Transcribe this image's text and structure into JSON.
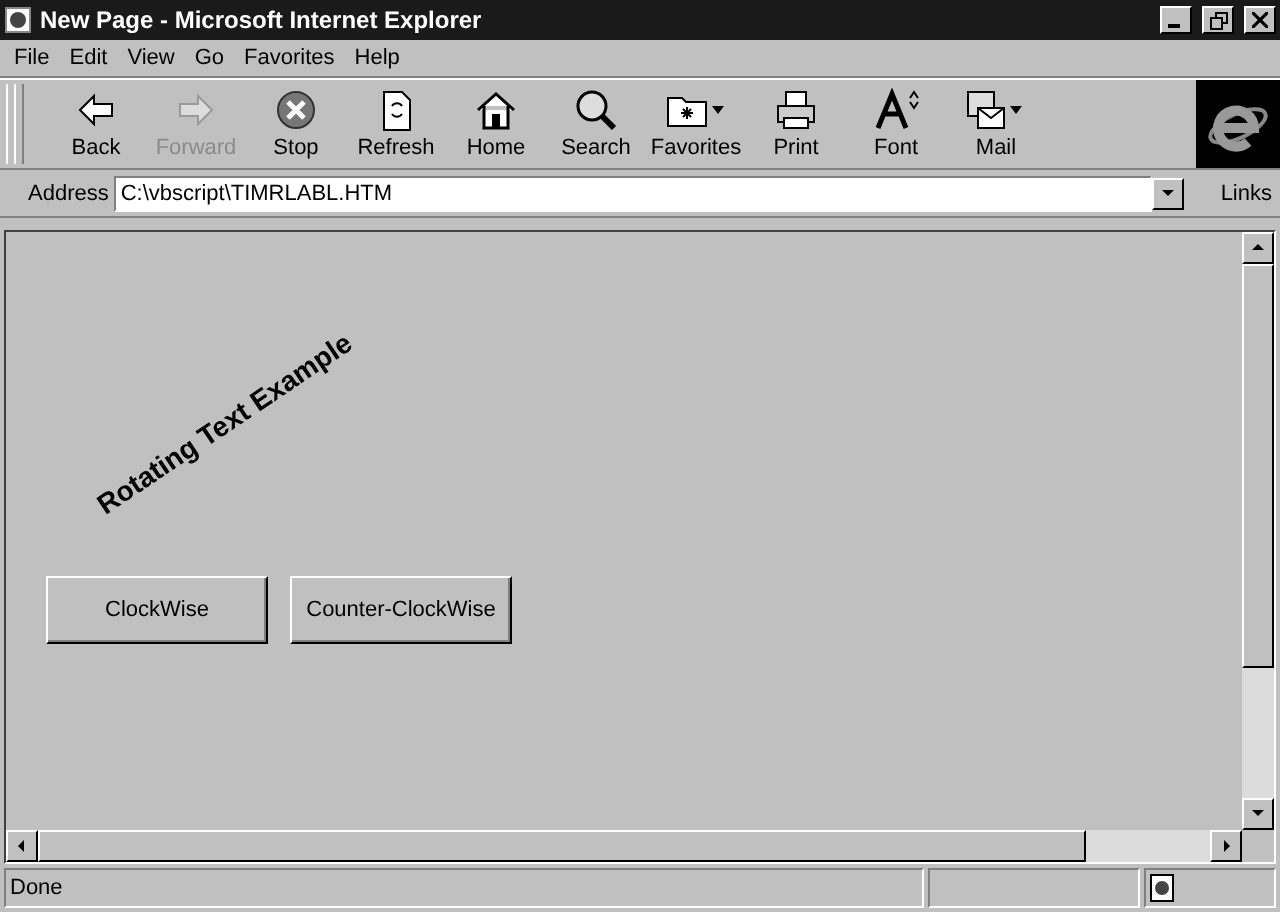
{
  "window": {
    "title": "New Page - Microsoft Internet Explorer"
  },
  "menu": [
    {
      "label": "File"
    },
    {
      "label": "Edit"
    },
    {
      "label": "View"
    },
    {
      "label": "Go"
    },
    {
      "label": "Favorites"
    },
    {
      "label": "Help"
    }
  ],
  "toolbar": [
    {
      "label": "Back",
      "kind": "back",
      "disabled": false
    },
    {
      "label": "Forward",
      "kind": "forward",
      "disabled": true
    },
    {
      "label": "Stop",
      "kind": "stop",
      "disabled": false
    },
    {
      "label": "Refresh",
      "kind": "refresh",
      "disabled": false
    },
    {
      "label": "Home",
      "kind": "home",
      "disabled": false
    },
    {
      "label": "Search",
      "kind": "search",
      "disabled": false
    },
    {
      "label": "Favorites",
      "kind": "favorites",
      "disabled": false
    },
    {
      "label": "Print",
      "kind": "print",
      "disabled": false
    },
    {
      "label": "Font",
      "kind": "font",
      "disabled": false
    },
    {
      "label": "Mail",
      "kind": "mail",
      "disabled": false
    }
  ],
  "address": {
    "label": "Address",
    "value": "C:\\vbscript\\TIMRLABL.HTM"
  },
  "links": {
    "label": "Links"
  },
  "page": {
    "rotating_text": "Rotating Text Example",
    "buttons": [
      "ClockWise",
      "Counter-ClockWise"
    ]
  },
  "status_bar": {
    "text": "Done"
  }
}
